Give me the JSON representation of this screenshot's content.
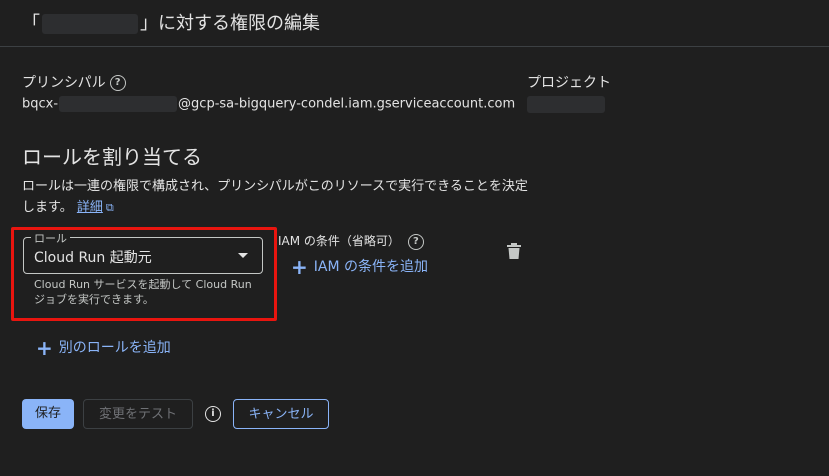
{
  "dialog": {
    "title_prefix": "「",
    "title_suffix": "」に対する権限の編集"
  },
  "principal": {
    "label": "プリンシパル",
    "value_prefix": "bqcx-",
    "value_suffix": "@gcp-sa-bigquery-condel.iam.gserviceaccount.com"
  },
  "project": {
    "label": "プロジェクト"
  },
  "roles_section": {
    "heading": "ロールを割り当てる",
    "description": "ロールは一連の権限で構成され、プリンシパルがこのリソースで実行できることを決定します。",
    "details_link": "詳細"
  },
  "role_select": {
    "label": "ロール",
    "value": "Cloud Run 起動元",
    "helper": "Cloud Run サービスを起動して Cloud Run ジョブを実行できます。"
  },
  "iam_condition": {
    "label": "IAM の条件（省略可）",
    "add_label": "IAM の条件を追加"
  },
  "add_role": {
    "label": "別のロールを追加"
  },
  "buttons": {
    "save": "保存",
    "test": "変更をテスト",
    "cancel": "キャンセル"
  },
  "icons": {
    "help": "help-circle-icon",
    "external_link": "external-link-icon",
    "dropdown": "arrow-drop-down-icon",
    "add": "plus-icon",
    "delete": "trash-icon",
    "info": "info-icon"
  },
  "colors": {
    "background": "#1f1f1f",
    "accent": "#8ab4f8",
    "highlight": "#e8150f"
  }
}
